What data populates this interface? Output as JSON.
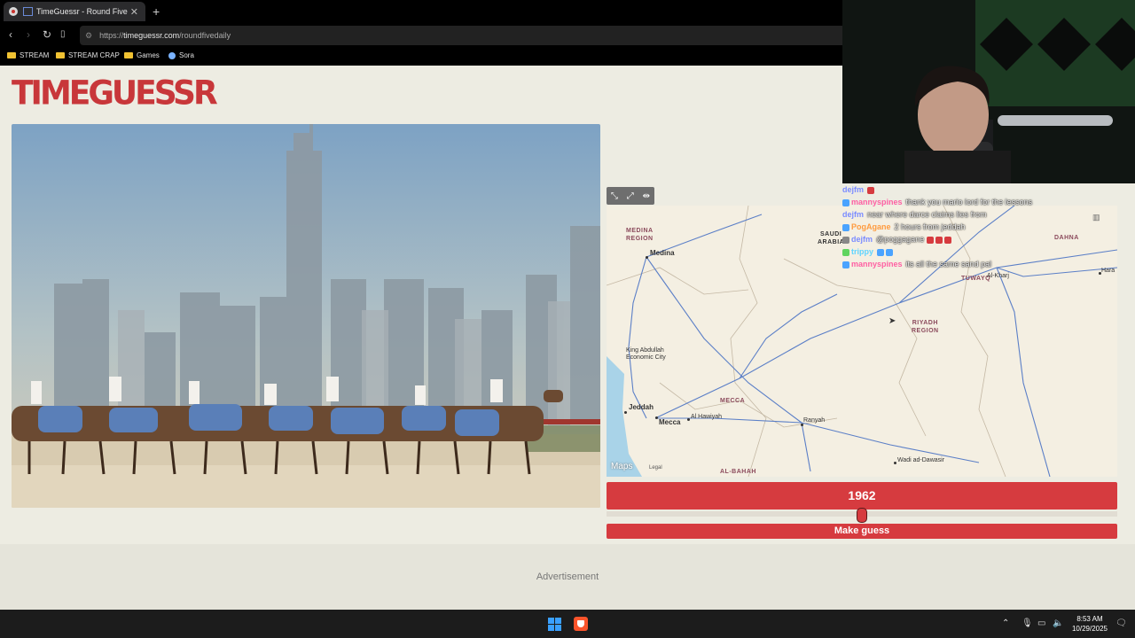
{
  "browser": {
    "tab_title": "TimeGuessr - Round Five",
    "tab_close": "✕",
    "new_tab": "+",
    "url_prefix": "https://",
    "url_domain": "timeguessr.com",
    "url_path": "/roundfivedaily",
    "bookmarks": [
      {
        "label": "STREAM",
        "icon": "folder-icon"
      },
      {
        "label": "STREAM CRAP",
        "icon": "folder-icon"
      },
      {
        "label": "Games",
        "icon": "folder-icon"
      },
      {
        "label": "Sora",
        "icon": "sora-icon"
      }
    ]
  },
  "site": {
    "logo": "TIMEGUESSR",
    "photo_alt": "Camel race with skyscrapers behind",
    "map": {
      "labels": {
        "medina": "Medina",
        "king_abdullah": "King Abdullah",
        "economic_city": "Economic City",
        "jeddah": "Jeddah",
        "mecca": "Mecca",
        "al_hawiyah": "Al Hawiyah",
        "ranyah": "Ranyah",
        "wadi": "Wadi ad-Dawasir",
        "al_kharj": "Al-Kharj",
        "harad": "Hara",
        "riyadh": "Riyadh"
      },
      "regions": {
        "medina_region_1": "MEDINA",
        "medina_region_2": "REGION",
        "saudi_1": "SAUDI",
        "saudi_2": "ARABIA",
        "riyadh_region_1": "RIYADH",
        "riyadh_region_2": "REGION",
        "mecca_region": "MECCA",
        "al_bahah": "AL-BAHAH",
        "tuwayq": "TUWAYQ",
        "dahna": "DAHNA"
      },
      "attribution": "Maps",
      "legal": "Legal"
    },
    "year": "1962",
    "year_slider_fraction": 0.5,
    "make_guess": "Make guess",
    "advertisement": "Advertisement"
  },
  "chat": [
    {
      "user": "dejfm",
      "color": "#7b8cff",
      "message": ""
    },
    {
      "user": "mannyspines",
      "color": "#ff5fa2",
      "message": "thank you mario lord for the lessons"
    },
    {
      "user": "dejfm",
      "color": "#7b8cff",
      "message": "near where darce claims lies from"
    },
    {
      "user": "PogAgane",
      "color": "#ff9b3f",
      "message": "2 hours from jeddah"
    },
    {
      "user": "dejfm",
      "color": "#7b8cff",
      "message": "@poggagane"
    },
    {
      "user": "trippy",
      "color": "#5fd4ff",
      "message": ""
    },
    {
      "user": "mannyspines",
      "color": "#ff5fa2",
      "message": "its all the same sand pal"
    }
  ],
  "taskbar": {
    "time": "8:53 AM",
    "date": "10/29/2025"
  },
  "colors": {
    "brand_red": "#d63b3f",
    "page_bg": "#edece2"
  }
}
